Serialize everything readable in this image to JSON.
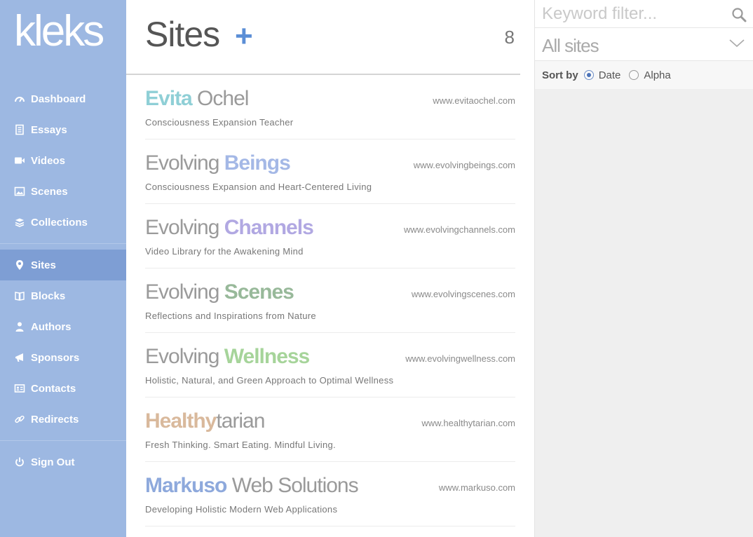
{
  "sidebar": {
    "logo": "kleks",
    "items": [
      {
        "label": "Dashboard",
        "icon": "gauge-icon"
      },
      {
        "label": "Essays",
        "icon": "document-icon"
      },
      {
        "label": "Videos",
        "icon": "video-camera-icon"
      },
      {
        "label": "Scenes",
        "icon": "picture-icon"
      },
      {
        "label": "Collections",
        "icon": "layers-icon"
      },
      {
        "label": "Sites",
        "icon": "map-pin-icon",
        "active": true
      },
      {
        "label": "Blocks",
        "icon": "book-icon"
      },
      {
        "label": "Authors",
        "icon": "user-icon"
      },
      {
        "label": "Sponsors",
        "icon": "megaphone-icon"
      },
      {
        "label": "Contacts",
        "icon": "address-card-icon"
      },
      {
        "label": "Redirects",
        "icon": "link-icon"
      },
      {
        "label": "Sign Out",
        "icon": "power-icon"
      }
    ]
  },
  "main": {
    "title": "Sites",
    "add_label": "+",
    "count": "8",
    "sites": [
      {
        "name_a": "Evita",
        "name_b": " Ochel",
        "bold_first": true,
        "color": "#8fcfd6",
        "url": "www.evitaochel.com",
        "description": "Consciousness Expansion Teacher"
      },
      {
        "name_a": "Evolving ",
        "name_b": "Beings",
        "bold_first": false,
        "color": "#a4b8e6",
        "url": "www.evolvingbeings.com",
        "description": "Consciousness Expansion and Heart-Centered Living"
      },
      {
        "name_a": "Evolving ",
        "name_b": "Channels",
        "bold_first": false,
        "color": "#b1a8e2",
        "url": "www.evolvingchannels.com",
        "description": "Video Library for the Awakening Mind"
      },
      {
        "name_a": "Evolving ",
        "name_b": "Scenes",
        "bold_first": false,
        "color": "#98b99a",
        "url": "www.evolvingscenes.com",
        "description": "Reflections and Inspirations from Nature"
      },
      {
        "name_a": "Evolving ",
        "name_b": "Wellness",
        "bold_first": false,
        "color": "#a6d49a",
        "url": "www.evolvingwellness.com",
        "description": "Holistic, Natural, and Green Approach to Optimal Wellness"
      },
      {
        "name_a": "Healthy",
        "name_b": "tarian",
        "bold_first": true,
        "color": "#d9b99c",
        "url": "www.healthytarian.com",
        "description": "Fresh Thinking. Smart Eating. Mindful Living."
      },
      {
        "name_a": "Markuso",
        "name_b": " Web Solutions",
        "bold_first": true,
        "color": "#8ea9dc",
        "url": "www.markuso.com",
        "description": "Developing Holistic Modern Web Applications"
      }
    ]
  },
  "filter": {
    "search_placeholder": "Keyword filter...",
    "search_value": "",
    "select_value": "All sites",
    "sort_label": "Sort by",
    "sort_options": [
      {
        "label": "Date",
        "checked": true
      },
      {
        "label": "Alpha",
        "checked": false
      }
    ]
  }
}
